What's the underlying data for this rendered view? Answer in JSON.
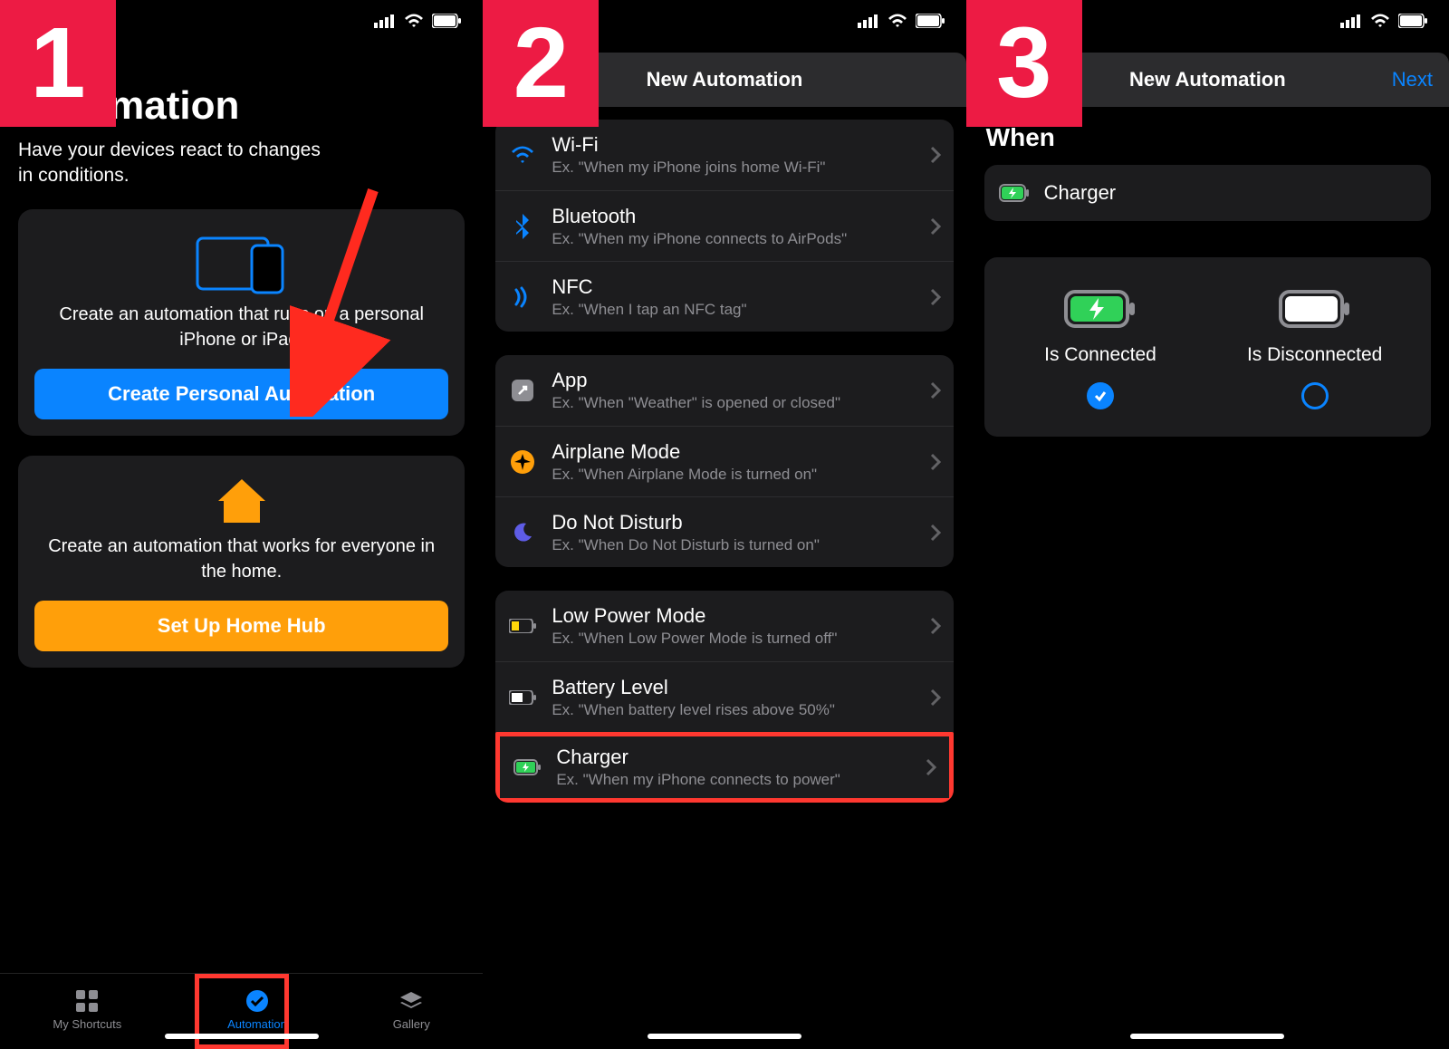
{
  "steps": {
    "one": "1",
    "two": "2",
    "three": "3"
  },
  "s1": {
    "title": "Automation",
    "subtitle": "Have your devices react to changes in conditions.",
    "personal_blurb": "Create an automation that runs on a personal iPhone or iPad.",
    "personal_btn": "Create Personal Automation",
    "home_blurb": "Create an automation that works for everyone in the home.",
    "home_btn": "Set Up Home Hub",
    "tabs": {
      "shortcuts": "My Shortcuts",
      "automation": "Automation",
      "gallery": "Gallery"
    }
  },
  "s2": {
    "header": "New Automation",
    "groups": [
      [
        {
          "title": "Wi-Fi",
          "sub": "Ex. \"When my iPhone joins home Wi-Fi\""
        },
        {
          "title": "Bluetooth",
          "sub": "Ex. \"When my iPhone connects to AirPods\""
        },
        {
          "title": "NFC",
          "sub": "Ex. \"When I tap an NFC tag\""
        }
      ],
      [
        {
          "title": "App",
          "sub": "Ex. \"When \"Weather\" is opened or closed\""
        },
        {
          "title": "Airplane Mode",
          "sub": "Ex. \"When Airplane Mode is turned on\""
        },
        {
          "title": "Do Not Disturb",
          "sub": "Ex. \"When Do Not Disturb is turned on\""
        }
      ],
      [
        {
          "title": "Low Power Mode",
          "sub": "Ex. \"When Low Power Mode is turned off\""
        },
        {
          "title": "Battery Level",
          "sub": "Ex. \"When battery level rises above 50%\""
        },
        {
          "title": "Charger",
          "sub": "Ex. \"When my iPhone connects to power\""
        }
      ]
    ]
  },
  "s3": {
    "header": "New Automation",
    "next": "Next",
    "when": "When",
    "trigger": "Charger",
    "opt_connected": "Is Connected",
    "opt_disconnected": "Is Disconnected"
  }
}
